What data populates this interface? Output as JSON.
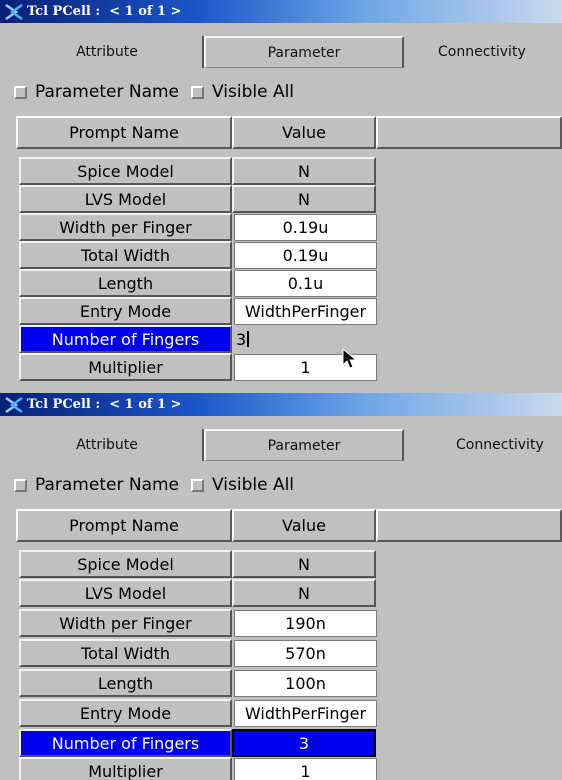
{
  "panels": [
    {
      "title": "Tcl PCell :  < 1 of 1 >",
      "tabs": [
        "Attribute",
        "Parameter",
        "Connectivity"
      ],
      "checkboxes": [
        "Parameter Name",
        "Visible All"
      ],
      "columns": [
        "Prompt Name",
        "Value"
      ],
      "rows": [
        {
          "prompt": "Spice Model",
          "value": "N"
        },
        {
          "prompt": "LVS Model",
          "value": "N"
        },
        {
          "prompt": "Width per Finger",
          "value": "0.19u"
        },
        {
          "prompt": "Total Width",
          "value": "0.19u"
        },
        {
          "prompt": "Length",
          "value": "0.1u"
        },
        {
          "prompt": "Entry Mode",
          "value": "WidthPerFinger"
        },
        {
          "prompt": "Number of Fingers",
          "value": "3"
        },
        {
          "prompt": "Multiplier",
          "value": "1"
        }
      ]
    },
    {
      "title": "Tcl PCell :  < 1 of 1 >",
      "tabs": [
        "Attribute",
        "Parameter",
        "Connectivity"
      ],
      "checkboxes": [
        "Parameter Name",
        "Visible All"
      ],
      "columns": [
        "Prompt Name",
        "Value"
      ],
      "rows": [
        {
          "prompt": "Spice Model",
          "value": "N"
        },
        {
          "prompt": "LVS Model",
          "value": "N"
        },
        {
          "prompt": "Width per Finger",
          "value": "190n"
        },
        {
          "prompt": "Total Width",
          "value": "570n"
        },
        {
          "prompt": "Length",
          "value": "100n"
        },
        {
          "prompt": "Entry Mode",
          "value": "WidthPerFinger"
        },
        {
          "prompt": "Number of Fingers",
          "value": "3"
        },
        {
          "prompt": "Multiplier",
          "value": "1"
        }
      ]
    }
  ],
  "colors": {
    "selection": "#0000ee",
    "window_bg": "#c0c0c0",
    "titlebar_start": "#0a1f78",
    "titlebar_end": "#c9d9ee"
  }
}
